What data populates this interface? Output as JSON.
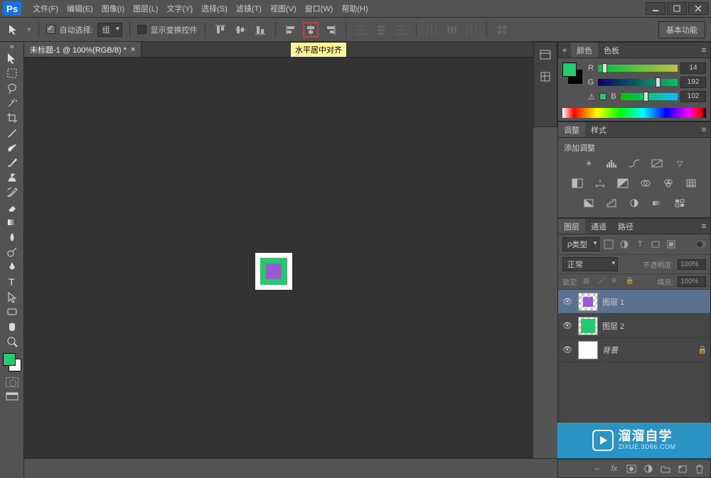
{
  "app": {
    "logo": "Ps"
  },
  "menu": [
    "文件(F)",
    "编辑(E)",
    "图像(I)",
    "图层(L)",
    "文字(Y)",
    "选择(S)",
    "滤镜(T)",
    "视图(V)",
    "窗口(W)",
    "帮助(H)"
  ],
  "options": {
    "auto_select_label": "自动选择:",
    "auto_select_value": "组",
    "show_transform": "显示变换控件",
    "tooltip": "水平居中对齐",
    "primary_btn": "基本功能"
  },
  "tab": {
    "title": "未标题-1 @ 100%(RGB/8) *"
  },
  "colorPanel": {
    "tab_color": "颜色",
    "tab_swatches": "色板",
    "fg": "#27c86f",
    "r_label": "R",
    "r_value": "14",
    "g_label": "G",
    "g_value": "192",
    "b_label": "B",
    "b_value": "102"
  },
  "adjustPanel": {
    "tab_adjust": "调整",
    "tab_styles": "样式",
    "add_label": "添加调整"
  },
  "layersPanel": {
    "tab_layers": "图层",
    "tab_channels": "通道",
    "tab_paths": "路径",
    "type_label": "类型",
    "blend_mode": "正常",
    "opacity_label": "不透明度:",
    "opacity_value": "100%",
    "lock_label": "锁定:",
    "fill_label": "填充:",
    "fill_value": "100%",
    "layers": [
      {
        "name": "图层 1",
        "kind": "purple"
      },
      {
        "name": "图层 2",
        "kind": "green"
      },
      {
        "name": "背景",
        "kind": "white",
        "locked": true
      }
    ]
  },
  "watermark": {
    "cn": "溜溜自学",
    "url": "ZIXUE.3D66.COM"
  }
}
